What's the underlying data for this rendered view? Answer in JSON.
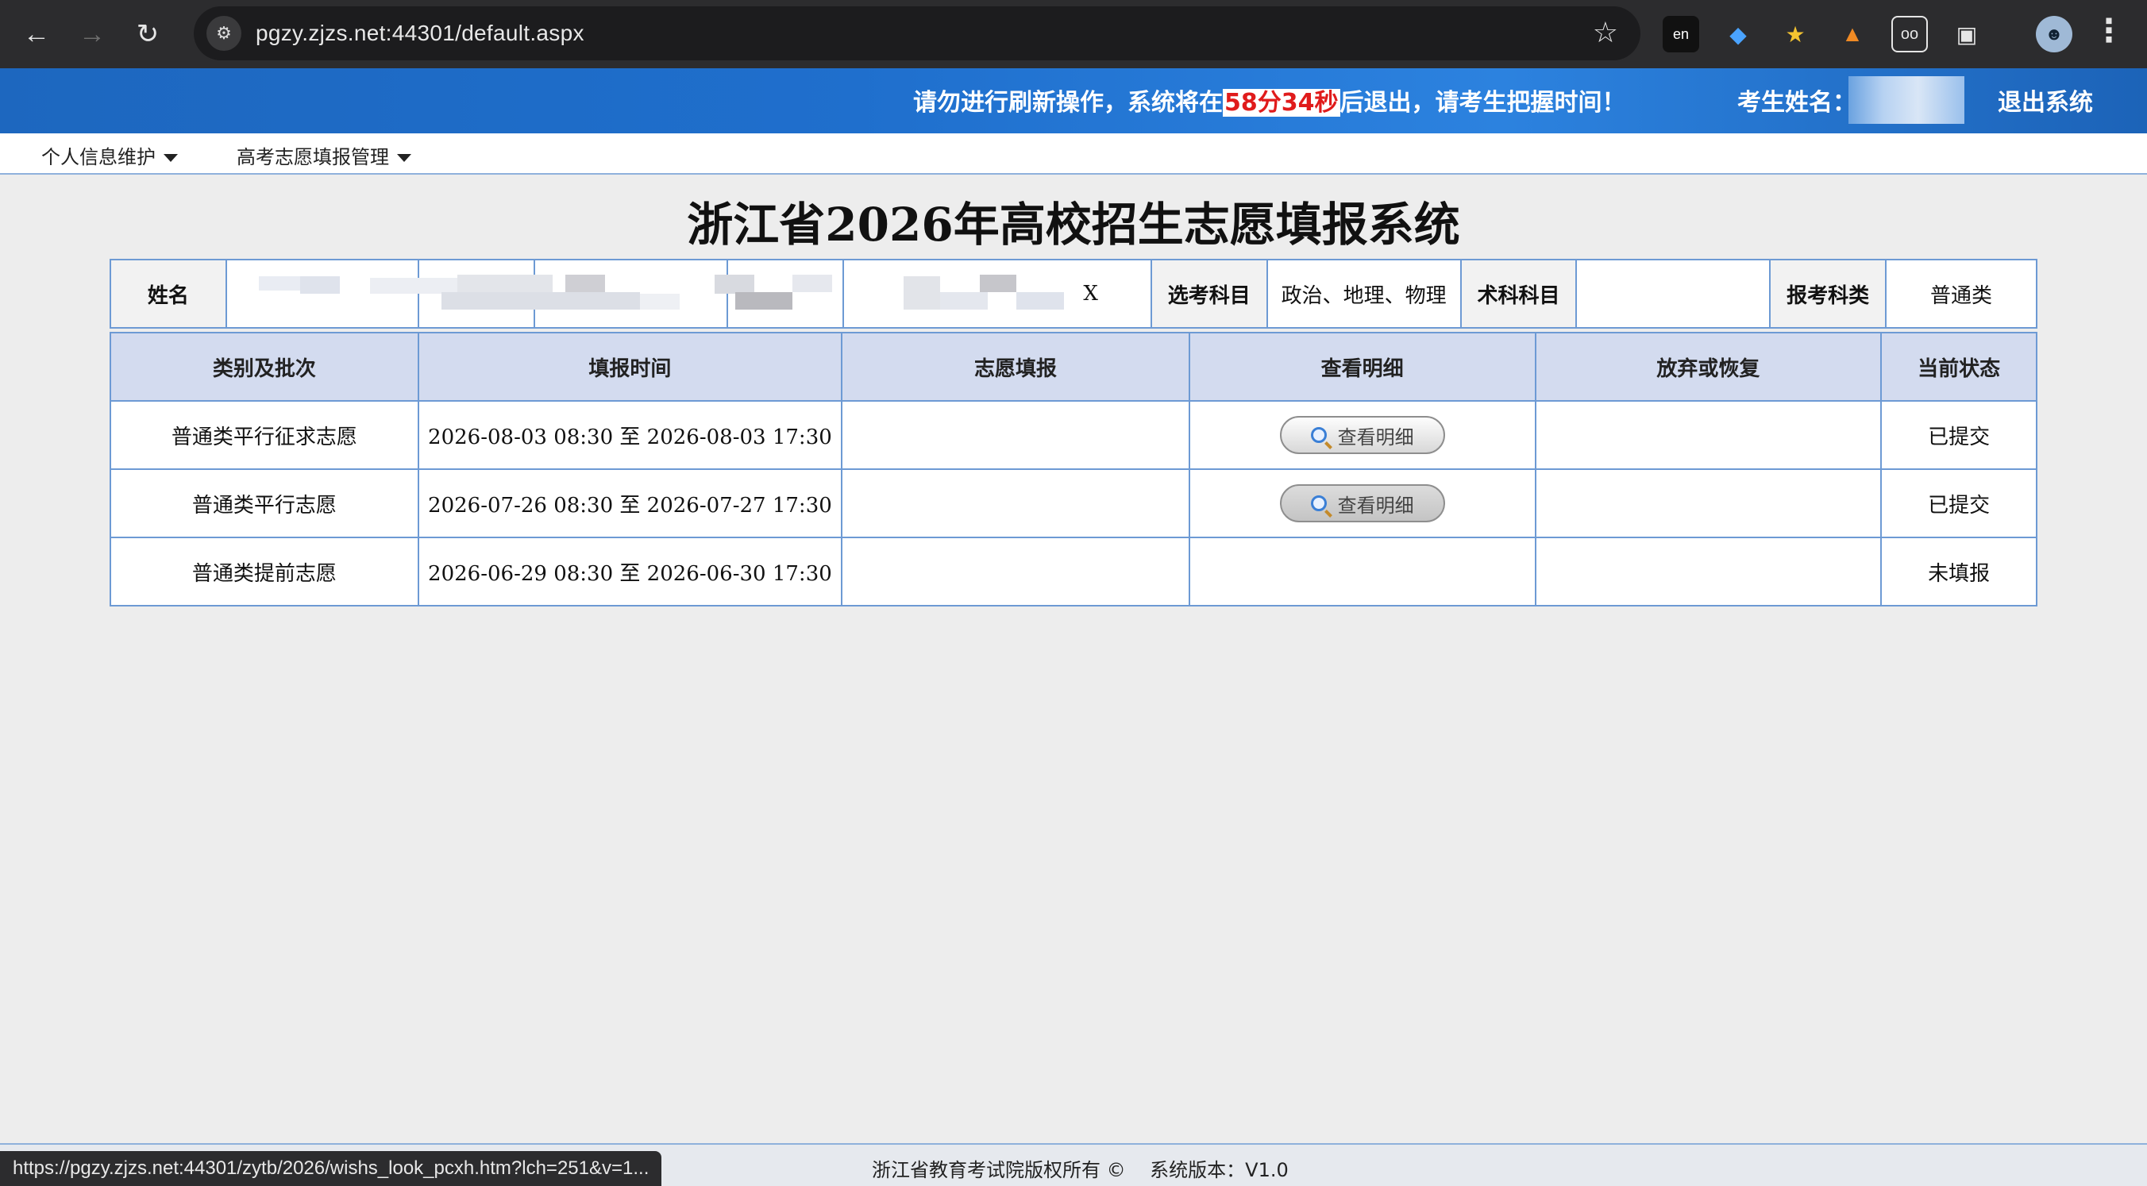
{
  "browser": {
    "url": "pgzy.zjzs.net:44301/default.aspx",
    "status_url": "https://pgzy.zjzs.net:44301/zytb/2026/wishs_look_pcxh.htm?lch=251&v=1..."
  },
  "banner": {
    "notice_prefix": "请勿进行刷新操作，系统将在",
    "countdown": "58分34秒",
    "notice_suffix": "后退出，请考生把握时间！",
    "student_label": "考生姓名：",
    "logout": "退出系统"
  },
  "menu": {
    "items": [
      {
        "label": "个人信息维护"
      },
      {
        "label": "高考志愿填报管理"
      }
    ]
  },
  "page_title": "浙江省2026年高校招生志愿填报系统",
  "info": {
    "name_label": "姓名",
    "masked_suffix": "X",
    "subjects_label": "选考科目",
    "subjects_value": "政治、地理、物理",
    "art_label": "术科科目",
    "art_value": "",
    "category_label": "报考科类",
    "category_value": "普通类"
  },
  "table": {
    "headers": [
      "类别及批次",
      "填报时间",
      "志愿填报",
      "查看明细",
      "放弃或恢复",
      "当前状态"
    ],
    "rows": [
      {
        "batch": "普通类平行征求志愿",
        "time": "2026-08-03 08:30 至 2026-08-03 17:30",
        "fill": "",
        "detail": "查看明细",
        "abandon": "",
        "status": "已提交"
      },
      {
        "batch": "普通类平行志愿",
        "time": "2026-07-26 08:30 至 2026-07-27 17:30",
        "fill": "",
        "detail": "查看明细",
        "abandon": "",
        "status": "已提交"
      },
      {
        "batch": "普通类提前志愿",
        "time": "2026-06-29 08:30 至 2026-06-30 17:30",
        "fill": "",
        "detail": "",
        "abandon": "",
        "status": "未填报"
      }
    ]
  },
  "footer": {
    "copyright": "浙江省教育考试院版权所有 ©",
    "version": "系统版本：V1.0"
  }
}
